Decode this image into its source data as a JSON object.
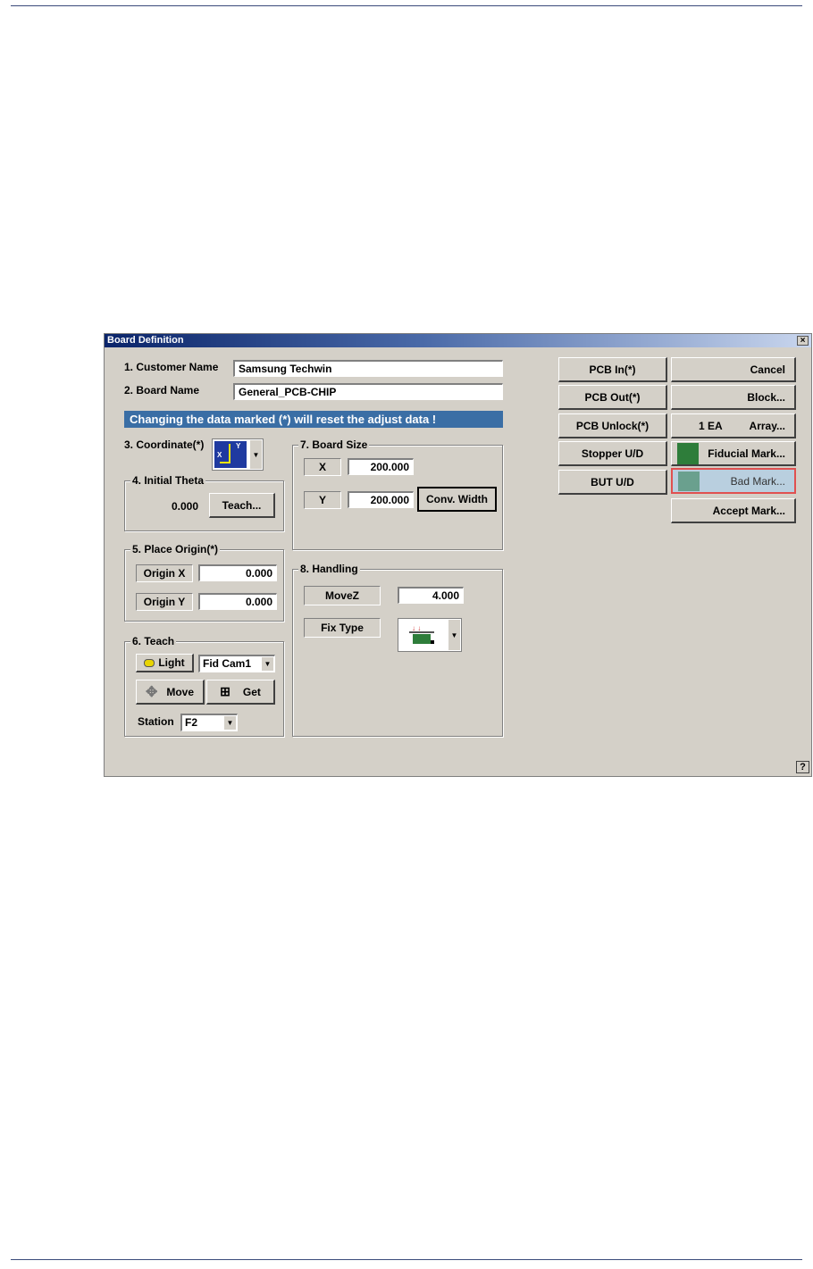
{
  "dialog": {
    "title": "Board Definition",
    "close_glyph": "×",
    "help_glyph": "?",
    "warning_banner": "Changing the data marked (*) will reset the adjust data !",
    "customer_name": {
      "label": "1. Customer Name",
      "value": "Samsung Techwin"
    },
    "board_name": {
      "label": "2. Board Name",
      "value": "General_PCB-CHIP"
    },
    "coordinate": {
      "label": "3. Coordinate(*)",
      "axis_y": "Y",
      "axis_x": "X"
    },
    "initial_theta": {
      "title": "4. Initial Theta",
      "value": "0.000",
      "teach_button": "Teach..."
    },
    "place_origin": {
      "title": "5. Place Origin(*)",
      "origin_x_label": "Origin X",
      "origin_x_value": "0.000",
      "origin_y_label": "Origin Y",
      "origin_y_value": "0.000"
    },
    "teach": {
      "title": "6. Teach",
      "light_button": "Light",
      "camera_select": "Fid Cam1",
      "move_button": "Move",
      "get_button": "Get",
      "station_label": "Station",
      "station_select": "F2"
    },
    "board_size": {
      "title": "7. Board Size",
      "x_label": "X",
      "x_value": "200.000",
      "y_label": "Y",
      "y_value": "200.000",
      "conv_width_button": "Conv. Width"
    },
    "handling": {
      "title": "8. Handling",
      "movez_label": "MoveZ",
      "movez_value": "4.000",
      "fix_type_label": "Fix Type"
    },
    "right_buttons": {
      "pcb_in": "PCB In(*)",
      "pcb_out": "PCB Out(*)",
      "pcb_unlock": "PCB Unlock(*)",
      "stopper_ud": "Stopper U/D",
      "but_ud": "BUT U/D",
      "cancel": "Cancel",
      "block": "Block...",
      "array_count": "1 EA",
      "array": "Array...",
      "fiducial_mark": "Fiducial Mark...",
      "bad_mark": "Bad Mark...",
      "accept_mark": "Accept Mark..."
    },
    "colors": {
      "banner": "#3a6ea5",
      "fiducial_swatch": "#2e7d3a",
      "highlight_border": "#e05050"
    }
  }
}
